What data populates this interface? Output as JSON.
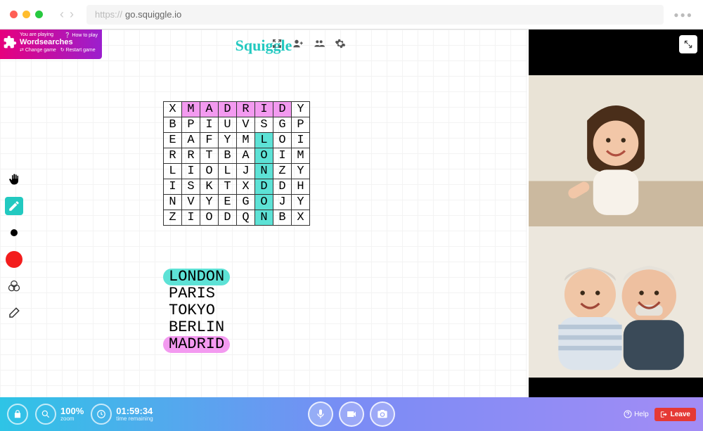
{
  "browser": {
    "scheme": "https://",
    "url": "go.squiggle.io"
  },
  "brand": "Squiggle",
  "game_badge": {
    "playing_label": "You are playing",
    "how_to_play": "How to play",
    "title": "Wordsearches",
    "change_game": "Change game",
    "restart_game": "Restart game"
  },
  "wordsearch": {
    "grid": [
      [
        "X",
        "M",
        "A",
        "D",
        "R",
        "I",
        "D",
        "Y"
      ],
      [
        "B",
        "P",
        "I",
        "U",
        "V",
        "S",
        "G",
        "P"
      ],
      [
        "E",
        "A",
        "F",
        "Y",
        "M",
        "L",
        "O",
        "I"
      ],
      [
        "R",
        "R",
        "T",
        "B",
        "A",
        "O",
        "I",
        "M"
      ],
      [
        "L",
        "I",
        "O",
        "L",
        "J",
        "N",
        "Z",
        "Y"
      ],
      [
        "I",
        "S",
        "K",
        "T",
        "X",
        "D",
        "D",
        "H"
      ],
      [
        "N",
        "V",
        "Y",
        "E",
        "G",
        "O",
        "J",
        "Y"
      ],
      [
        "Z",
        "I",
        "O",
        "D",
        "Q",
        "N",
        "B",
        "X"
      ]
    ],
    "highlights": {
      "madrid": {
        "color": "pink",
        "cells": [
          [
            0,
            1
          ],
          [
            0,
            2
          ],
          [
            0,
            3
          ],
          [
            0,
            4
          ],
          [
            0,
            5
          ],
          [
            0,
            6
          ]
        ]
      },
      "london": {
        "color": "teal",
        "cells": [
          [
            2,
            5
          ],
          [
            3,
            5
          ],
          [
            4,
            5
          ],
          [
            5,
            5
          ],
          [
            6,
            5
          ],
          [
            7,
            5
          ]
        ]
      }
    },
    "words": [
      {
        "text": "LONDON",
        "found": true,
        "color": "teal"
      },
      {
        "text": "PARIS",
        "found": false,
        "color": null
      },
      {
        "text": "TOKYO",
        "found": false,
        "color": null
      },
      {
        "text": "BERLIN",
        "found": false,
        "color": null
      },
      {
        "text": "MADRID",
        "found": true,
        "color": "pink"
      }
    ]
  },
  "bottom_bar": {
    "zoom_value": "100%",
    "zoom_label": "zoom",
    "time_value": "01:59:34",
    "time_label": "time remaining",
    "help_label": "Help",
    "leave_label": "Leave"
  }
}
